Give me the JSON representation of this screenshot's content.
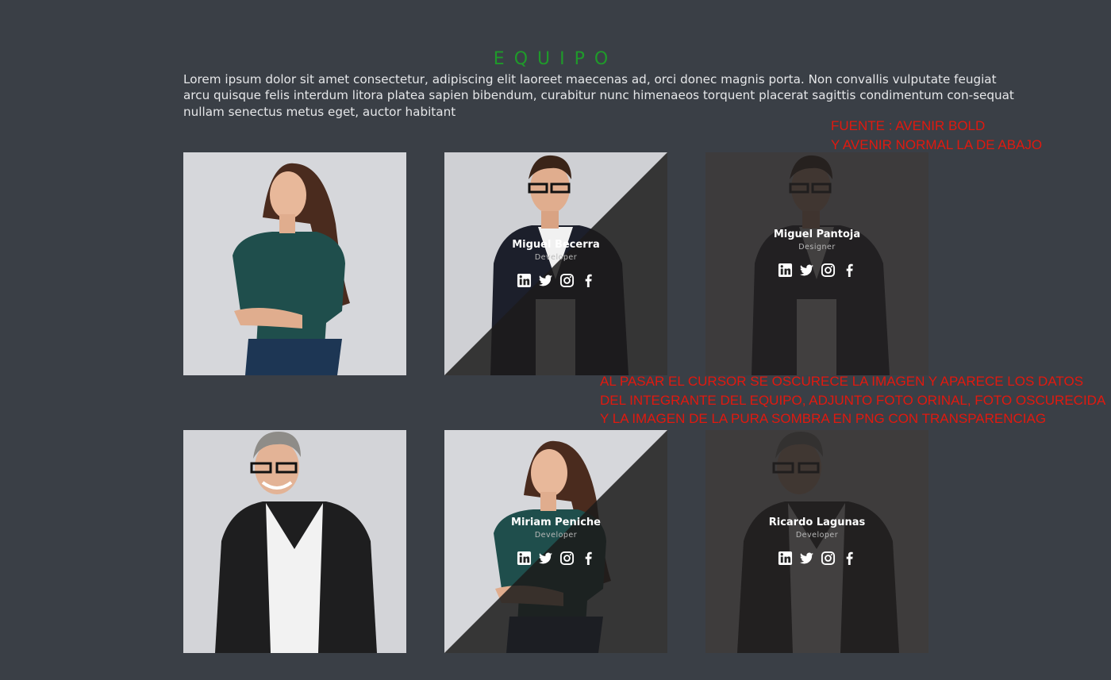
{
  "section": {
    "title": "EQUIPO",
    "intro": "Lorem ipsum dolor sit amet consectetur, adipiscing elit laoreet maecenas ad, orci donec magnis porta. Non convallis vulputate feugiat arcu quisque felis interdum litora platea sapien bibendum, curabitur nunc himenaeos torquent placerat sagittis condimentum con-sequat nullam senectus metus eget, auctor habitant"
  },
  "notes": {
    "font": [
      "FUENTE : AVENIR BOLD",
      "Y AVENIR NORMAL LA DE ABAJO"
    ],
    "hover": [
      "AL PASAR EL CURSOR SE OSCURECE LA IMAGEN Y APARECE LOS DATOS",
      "DEL INTEGRANTE DEL EQUIPO, ADJUNTO FOTO ORINAL, FOTO OSCURECIDA",
      " Y LA  IMAGEN DE  LA PURA SOMBRA EN PNG CON TRANSPARENCIAG"
    ]
  },
  "team": [
    {
      "name": "Miguel Becerra",
      "role": "Developer"
    },
    {
      "name": "Miguel Pantoja",
      "role": "Designer"
    },
    {
      "name": "Miriam Peniche",
      "role": "Developer"
    },
    {
      "name": "Ricardo Lagunas",
      "role": "Developer"
    }
  ],
  "social_icons": [
    "linkedin-icon",
    "twitter-icon",
    "instagram-icon",
    "facebook-icon"
  ],
  "colors": {
    "background": "#3a3f46",
    "title": "#1f9a2a",
    "annotation": "#e1190f"
  }
}
